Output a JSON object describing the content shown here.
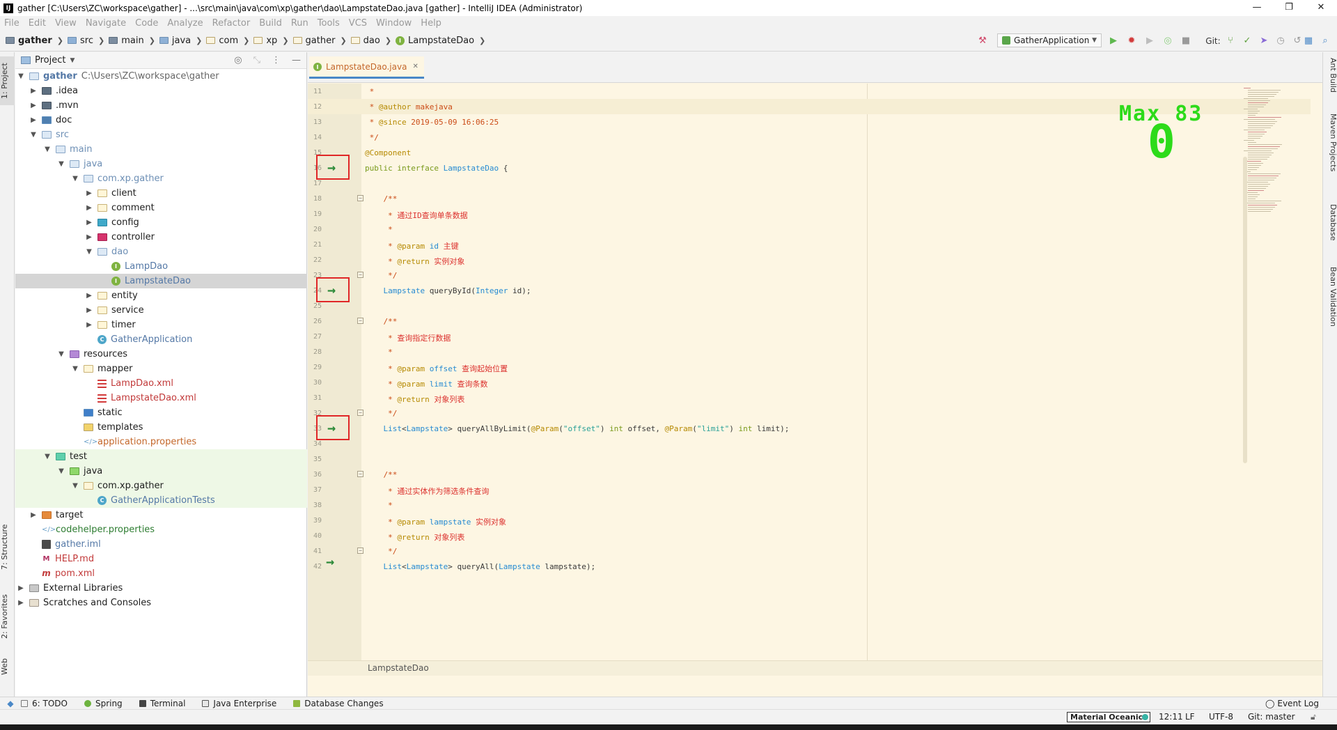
{
  "window": {
    "title": "gather [C:\\Users\\ZC\\workspace\\gather] - ...\\src\\main\\java\\com\\xp\\gather\\dao\\LampstateDao.java [gather] - IntelliJ IDEA (Administrator)",
    "app_icon": "IJ",
    "minimize": "—",
    "restore": "❐",
    "close": "✕"
  },
  "menu": [
    "File",
    "Edit",
    "View",
    "Navigate",
    "Code",
    "Analyze",
    "Refactor",
    "Build",
    "Run",
    "Tools",
    "VCS",
    "Window",
    "Help"
  ],
  "breadcrumb": [
    "gather",
    "src",
    "main",
    "java",
    "com",
    "xp",
    "gather",
    "dao",
    "LampstateDao"
  ],
  "toolbar": {
    "run_config": "GatherApplication",
    "git_label": "Git:"
  },
  "left_stripe": {
    "project": "1: Project",
    "structure": "7: Structure",
    "favorites": "2: Favorites",
    "web": "Web"
  },
  "right_stripe": {
    "ant": "Ant Build",
    "maven": "Maven Projects",
    "database": "Database",
    "bean": "Bean Validation"
  },
  "project_panel": {
    "title": "Project",
    "tree": [
      {
        "label": "gather",
        "path": "C:\\Users\\ZC\\workspace\\gather"
      },
      {
        "label": ".idea"
      },
      {
        "label": ".mvn"
      },
      {
        "label": "doc"
      },
      {
        "label": "src"
      },
      {
        "label": "main"
      },
      {
        "label": "java"
      },
      {
        "label": "com.xp.gather"
      },
      {
        "label": "client"
      },
      {
        "label": "comment"
      },
      {
        "label": "config"
      },
      {
        "label": "controller"
      },
      {
        "label": "dao"
      },
      {
        "label": "LampDao"
      },
      {
        "label": "LampstateDao"
      },
      {
        "label": "entity"
      },
      {
        "label": "service"
      },
      {
        "label": "timer"
      },
      {
        "label": "GatherApplication"
      },
      {
        "label": "resources"
      },
      {
        "label": "mapper"
      },
      {
        "label": "LampDao.xml"
      },
      {
        "label": "LampstateDao.xml"
      },
      {
        "label": "static"
      },
      {
        "label": "templates"
      },
      {
        "label": "application.properties"
      },
      {
        "label": "test"
      },
      {
        "label": "java"
      },
      {
        "label": "com.xp.gather"
      },
      {
        "label": "GatherApplicationTests"
      },
      {
        "label": "target"
      },
      {
        "label": "codehelper.properties"
      },
      {
        "label": "gather.iml"
      },
      {
        "label": "HELP.md"
      },
      {
        "label": "pom.xml"
      },
      {
        "label": "External Libraries"
      },
      {
        "label": "Scratches and Consoles"
      }
    ]
  },
  "editor": {
    "tab": "LampstateDao.java",
    "bottom_breadcrumb": "LampstateDao",
    "lines": [
      {
        "n": "11",
        "text": " *"
      },
      {
        "n": "12",
        "text": " * @author makejava"
      },
      {
        "n": "13",
        "text": " * @since 2019-05-09 16:06:25"
      },
      {
        "n": "14",
        "text": " */"
      },
      {
        "n": "15",
        "text": "@Component"
      },
      {
        "n": "16",
        "text": "public interface LampstateDao {"
      },
      {
        "n": "17",
        "text": ""
      },
      {
        "n": "18",
        "text": "    /**"
      },
      {
        "n": "19",
        "text": "     * 通过ID查询单条数据"
      },
      {
        "n": "20",
        "text": "     *"
      },
      {
        "n": "21",
        "text": "     * @param id 主键"
      },
      {
        "n": "22",
        "text": "     * @return 实例对象"
      },
      {
        "n": "23",
        "text": "     */"
      },
      {
        "n": "24",
        "text": "    Lampstate queryById(Integer id);"
      },
      {
        "n": "25",
        "text": ""
      },
      {
        "n": "26",
        "text": "    /**"
      },
      {
        "n": "27",
        "text": "     * 查询指定行数据"
      },
      {
        "n": "28",
        "text": "     *"
      },
      {
        "n": "29",
        "text": "     * @param offset 查询起始位置"
      },
      {
        "n": "30",
        "text": "     * @param limit 查询条数"
      },
      {
        "n": "31",
        "text": "     * @return 对象列表"
      },
      {
        "n": "32",
        "text": "     */"
      },
      {
        "n": "33",
        "text": "    List<Lampstate> queryAllByLimit(@Param(\"offset\") int offset, @Param(\"limit\") int limit);"
      },
      {
        "n": "34",
        "text": ""
      },
      {
        "n": "35",
        "text": ""
      },
      {
        "n": "36",
        "text": "    /**"
      },
      {
        "n": "37",
        "text": "     * 通过实体作为筛选条件查询"
      },
      {
        "n": "38",
        "text": "     *"
      },
      {
        "n": "39",
        "text": "     * @param lampstate 实例对象"
      },
      {
        "n": "40",
        "text": "     * @return 对象列表"
      },
      {
        "n": "41",
        "text": "     */"
      },
      {
        "n": "42",
        "text": "    List<Lampstate> queryAll(Lampstate lampstate);"
      }
    ]
  },
  "overlay": {
    "max_label": "Max 83",
    "value": "0"
  },
  "bottom_tabs": {
    "todo": "6: TODO",
    "spring": "Spring",
    "terminal": "Terminal",
    "java_enterprise": "Java Enterprise",
    "db_changes": "Database Changes",
    "event_log": "Event Log"
  },
  "status": {
    "theme": "Material Oceanic",
    "position": "12:11",
    "line_sep": "LF",
    "encoding": "UTF-8",
    "git": "Git: master"
  },
  "colors": {
    "editor_bg": "#fdf6e3",
    "accent": "#4a88c7",
    "overlay_green": "#2ddb1a",
    "highlight_box": "#e02727"
  }
}
